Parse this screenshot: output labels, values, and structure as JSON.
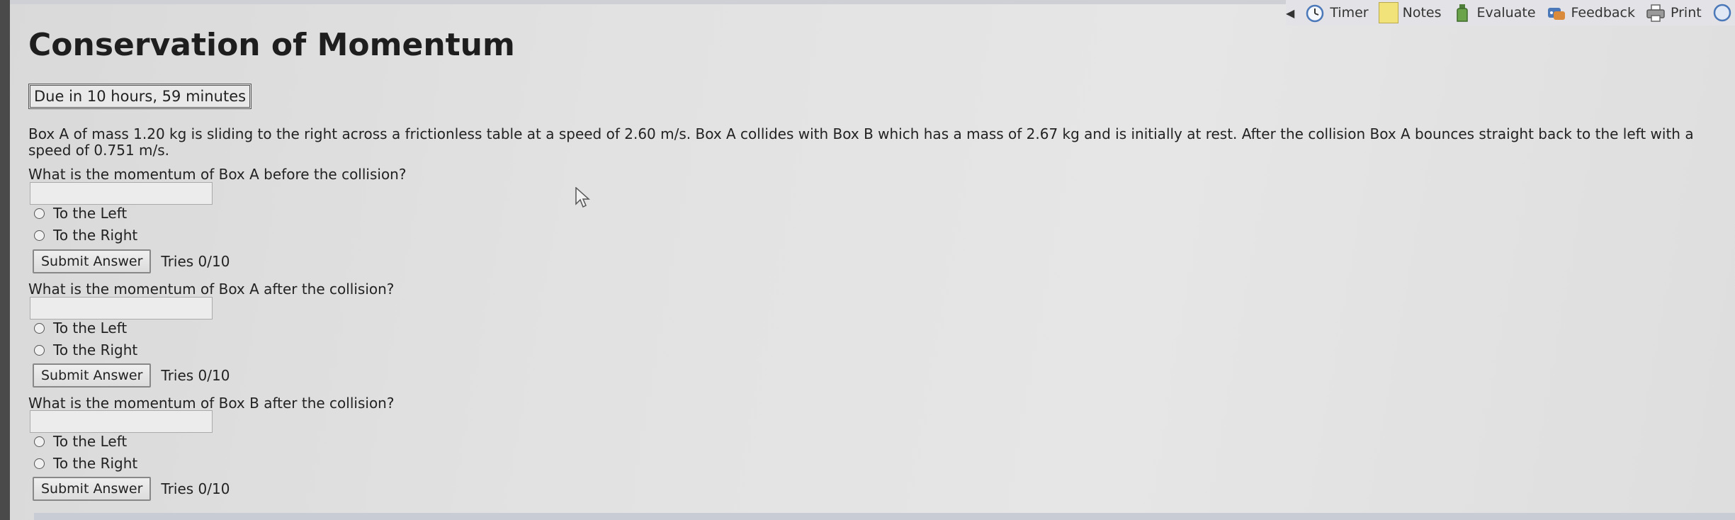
{
  "toolbar": {
    "items": [
      {
        "label": "Timer",
        "icon": "clock-icon"
      },
      {
        "label": "Notes",
        "icon": "notes-icon"
      },
      {
        "label": "Evaluate",
        "icon": "bottle-icon"
      },
      {
        "label": "Feedback",
        "icon": "feedback-icon"
      },
      {
        "label": "Print",
        "icon": "printer-icon"
      }
    ]
  },
  "page": {
    "title": "Conservation of Momentum",
    "due": "Due in 10 hours, 59 minutes",
    "problem_text": "Box A of mass 1.20 kg is sliding to the right across a frictionless table at a speed of 2.60 m/s. Box A collides with Box B which has a mass of 2.67 kg and is initially at rest. After the collision Box A bounces straight back to the left with a speed of 0.751 m/s."
  },
  "questions": [
    {
      "prompt": "What is the momentum of Box A before the collision?",
      "input_value": "",
      "options": [
        "To the Left",
        "To the Right"
      ],
      "submit_label": "Submit Answer",
      "tries": "Tries 0/10"
    },
    {
      "prompt": "What is the momentum of Box A after the collision?",
      "input_value": "",
      "options": [
        "To the Left",
        "To the Right"
      ],
      "submit_label": "Submit Answer",
      "tries": "Tries 0/10"
    },
    {
      "prompt": "What is the momentum of Box B after the collision?",
      "input_value": "",
      "options": [
        "To the Left",
        "To the Right"
      ],
      "submit_label": "Submit Answer",
      "tries": "Tries 0/10"
    }
  ]
}
